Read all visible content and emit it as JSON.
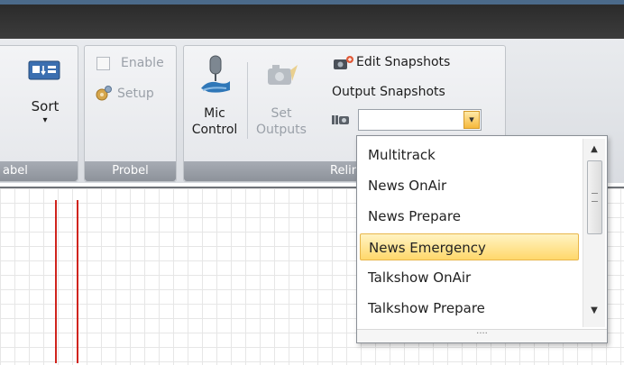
{
  "ribbon": {
    "sort_label": "Sort",
    "group_left_label": "abel",
    "enable_label": "Enable",
    "setup_label": "Setup",
    "group_probel_label": "Probel",
    "mic_line1": "Mic",
    "mic_line2": "Control",
    "set_line1": "Set",
    "set_line2": "Outputs",
    "edit_snapshots_label": "Edit Snapshots",
    "output_snapshots_label": "Output Snapshots",
    "group_relink_label": "Relin"
  },
  "snapshot_select": {
    "value": "",
    "dropdown_arrow": "▾"
  },
  "dropdown": {
    "items": [
      "Multitrack",
      "News OnAir",
      "News Prepare",
      "News Emergency",
      "Talkshow OnAir",
      "Talkshow Prepare"
    ],
    "selected_index": 3,
    "grip": "····"
  },
  "icons": {
    "sort": "sort-icon",
    "setup": "setup-icon",
    "mic": "microphone-icon",
    "set_outputs": "camera-icon",
    "edit_snapshots": "camera-edit-icon",
    "output_snapshots": "snapshot-icon"
  },
  "colors": {
    "selected_gradient_top": "#fff3c3",
    "selected_gradient_bottom": "#ffd86b",
    "marker_red": "#d0241d"
  }
}
